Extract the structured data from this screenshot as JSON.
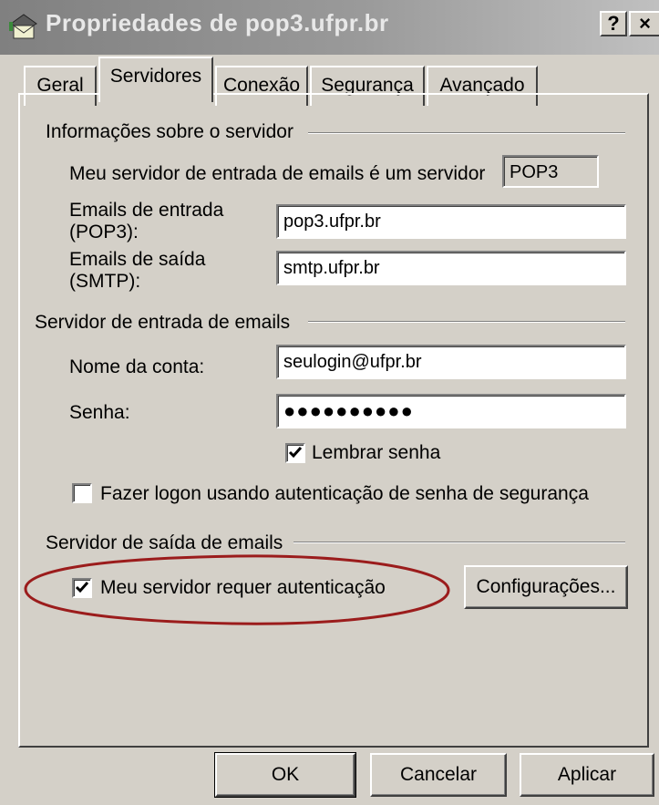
{
  "window": {
    "title": "Propriedades de pop3.ufpr.br",
    "help_label": "?",
    "close_label": "×"
  },
  "tabs": [
    {
      "label": "Geral",
      "active": false
    },
    {
      "label": "Servidores",
      "active": true
    },
    {
      "label": "Conexão",
      "active": false
    },
    {
      "label": "Segurança",
      "active": false
    },
    {
      "label": "Avançado",
      "active": false
    }
  ],
  "server_info": {
    "group_label": "Informações sobre o servidor",
    "incoming_type_label": "Meu servidor de entrada de emails é um  servidor",
    "incoming_type_value": "POP3",
    "incoming_label_line1": "Emails de entrada",
    "incoming_label_line2": "(POP3):",
    "incoming_value": "pop3.ufpr.br",
    "outgoing_label_line1": "Emails de saída",
    "outgoing_label_line2": "(SMTP):",
    "outgoing_value": "smtp.ufpr.br"
  },
  "incoming_server": {
    "group_label": "Servidor de entrada de emails",
    "account_label": "Nome da conta:",
    "account_value": "seulogin@ufpr.br",
    "password_label": "Senha:",
    "password_value": "●●●●●●●●●●",
    "remember_label": "Lembrar senha",
    "remember_checked": true,
    "spa_label": "Fazer logon usando autenticação de senha de segurança",
    "spa_checked": false
  },
  "outgoing_server": {
    "group_label": "Servidor de saída de emails",
    "auth_label": "Meu servidor requer autenticação",
    "auth_checked": true,
    "settings_label": "Configurações..."
  },
  "buttons": {
    "ok": "OK",
    "cancel": "Cancelar",
    "apply": "Aplicar"
  },
  "colors": {
    "face": "#d4d0c8",
    "annotation": "#9b1c1c"
  }
}
